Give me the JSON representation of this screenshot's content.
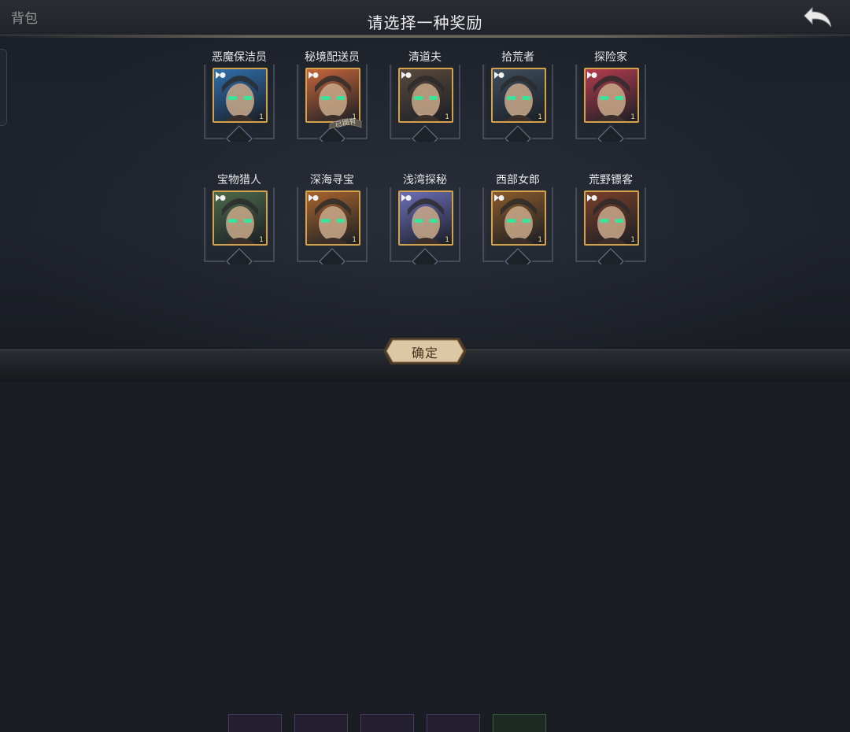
{
  "top_bar": {
    "bag_label": "背包"
  },
  "dialog": {
    "title": "请选择一种奖励",
    "confirm_label": "确定"
  },
  "rewards": [
    {
      "name": "恶魔保洁员",
      "level": "1",
      "owned": false,
      "palette": "#2f6fae"
    },
    {
      "name": "秘境配送员",
      "level": "1",
      "owned": true,
      "owned_label": "已拥有",
      "palette": "#c7663a"
    },
    {
      "name": "清道夫",
      "level": "1",
      "owned": false,
      "palette": "#5b4a3c"
    },
    {
      "name": "拾荒者",
      "level": "1",
      "owned": false,
      "palette": "#3e4e5e"
    },
    {
      "name": "探险家",
      "level": "1",
      "owned": false,
      "palette": "#b43c4e"
    },
    {
      "name": "宝物猎人",
      "level": "1",
      "owned": false,
      "palette": "#4e6a4a"
    },
    {
      "name": "深海寻宝",
      "level": "1",
      "owned": false,
      "palette": "#a8642e"
    },
    {
      "name": "浅湾探秘",
      "level": "1",
      "owned": false,
      "palette": "#6d6fb8"
    },
    {
      "name": "西部女郎",
      "level": "1",
      "owned": false,
      "palette": "#8a5a2a"
    },
    {
      "name": "荒野镖客",
      "level": "1",
      "owned": false,
      "palette": "#7a3f2a"
    }
  ],
  "colors": {
    "portrait_border": "#d3a24c",
    "frame_line": "#5b6170",
    "button_fill": "#dcc7a4"
  }
}
